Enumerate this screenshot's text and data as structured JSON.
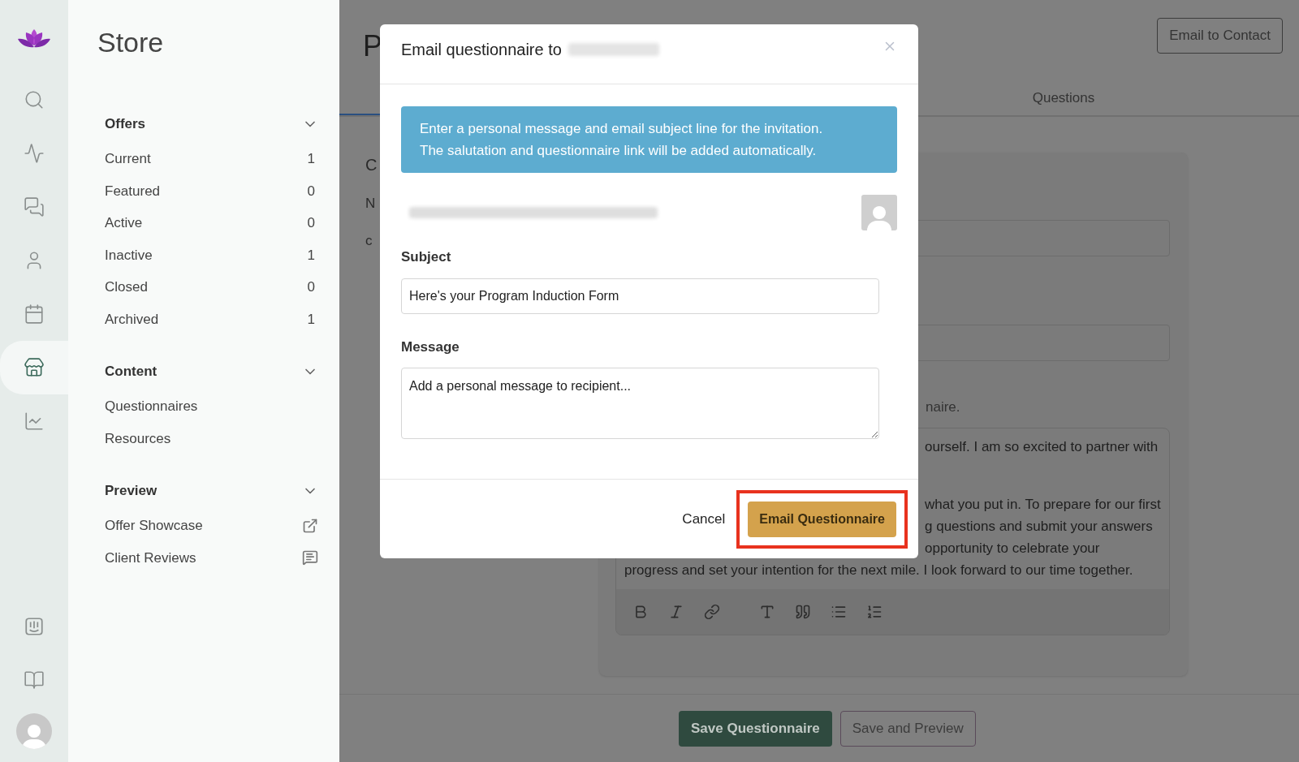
{
  "icon_rail": {
    "items": [
      {
        "kind": "search",
        "selected": false
      },
      {
        "kind": "activity",
        "selected": false
      },
      {
        "kind": "chat",
        "selected": false
      },
      {
        "kind": "user",
        "selected": false
      },
      {
        "kind": "calendar",
        "selected": false
      },
      {
        "kind": "store",
        "selected": true
      },
      {
        "kind": "chart",
        "selected": false
      }
    ],
    "bottom_items": [
      {
        "kind": "support"
      },
      {
        "kind": "book"
      }
    ]
  },
  "store_panel": {
    "title": "Store",
    "sections": [
      {
        "title": "Offers",
        "expanded": true,
        "items": [
          {
            "label": "Current",
            "count": "1"
          },
          {
            "label": "Featured",
            "count": "0"
          },
          {
            "label": "Active",
            "count": "0"
          },
          {
            "label": "Inactive",
            "count": "1"
          },
          {
            "label": "Closed",
            "count": "0"
          },
          {
            "label": "Archived",
            "count": "1"
          }
        ]
      },
      {
        "title": "Content",
        "expanded": true,
        "items": [
          {
            "label": "Questionnaires"
          },
          {
            "label": "Resources"
          }
        ]
      },
      {
        "title": "Preview",
        "expanded": true,
        "items": [
          {
            "label": "Offer Showcase",
            "kind": "external"
          },
          {
            "label": "Client Reviews",
            "kind": "reviews"
          }
        ]
      }
    ]
  },
  "page": {
    "title_fragment": "P",
    "email_contact_button": "Email to Contact",
    "tabs": [
      {
        "label": "Questions",
        "selected": false
      }
    ],
    "left_fragments": [
      "C",
      "N",
      "c"
    ],
    "hint_fragment": "naire.",
    "editor_lines": [
      "ourself. I am so excited to partner with",
      "what you put in. To prepare for our first",
      "g questions and submit your answers",
      "opportunity to celebrate your",
      "progress and set your intention for the next mile. I look forward to our time together."
    ],
    "toolbar": [
      {
        "kind": "bold"
      },
      {
        "kind": "italic"
      },
      {
        "kind": "link"
      },
      {
        "kind": "text-size"
      },
      {
        "kind": "quote"
      },
      {
        "kind": "bullet-list"
      },
      {
        "kind": "numbered-list"
      }
    ],
    "save_button": "Save Questionnaire",
    "preview_button": "Save and Preview"
  },
  "modal": {
    "title": "Email questionnaire to",
    "info_lines": [
      "Enter a personal message and email subject line for the invitation.",
      "The salutation and questionnaire link will be added automatically."
    ],
    "subject_label": "Subject",
    "subject_value": "Here's your Program Induction Form",
    "message_label": "Message",
    "message_placeholder": "Add a personal message to recipient...",
    "cancel": "Cancel",
    "submit": "Email Questionnaire",
    "submit_highlighted": true
  }
}
